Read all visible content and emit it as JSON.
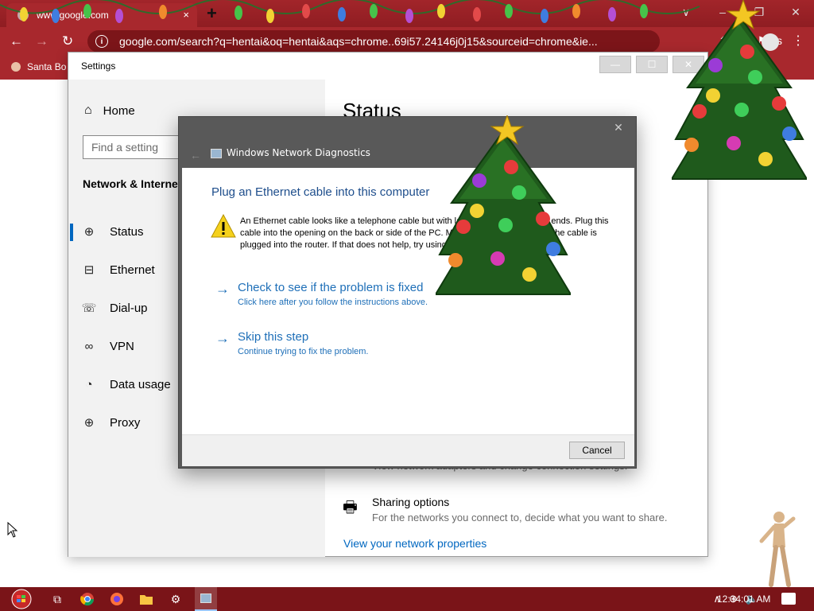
{
  "browser": {
    "tab_title": "www.google.com",
    "tab_close": "×",
    "new_tab": "+",
    "url": "google.com/search?q=hentai&oq=hentai&aqs=chrome..69i57.24146j0j15&sourceid=chrome&ie...",
    "info_glyph": "i",
    "bookmark_label": "Santa Bo",
    "ext_badge": "s",
    "win_ctrls": [
      "∨",
      "–",
      "❐",
      "✕"
    ]
  },
  "settings": {
    "title": "Settings",
    "home_label": "Home",
    "search_placeholder": "Find a setting",
    "section": "Network & Internet",
    "nav": [
      {
        "label": "Status",
        "icon": "status-icon"
      },
      {
        "label": "Ethernet",
        "icon": "ethernet-icon"
      },
      {
        "label": "Dial-up",
        "icon": "dialup-icon"
      },
      {
        "label": "VPN",
        "icon": "vpn-icon"
      },
      {
        "label": "Data usage",
        "icon": "data-usage-icon"
      },
      {
        "label": "Proxy",
        "icon": "proxy-icon"
      }
    ],
    "main_title": "Status",
    "adapter_text": "View network adapters and change connection settings.",
    "sharing_title": "Sharing options",
    "sharing_desc": "For the networks you connect to, decide what you want to share.",
    "view_props": "View your network properties"
  },
  "dialog": {
    "title": "Windows Network Diagnostics",
    "heading": "Plug an Ethernet cable into this computer",
    "message": "An Ethernet cable looks like a telephone cable but with larger connectors on the ends. Plug this cable into the opening on the back or side of the PC. Make sure the other end of the cable is plugged into the router. If that does not help, try using a different cable.",
    "options": [
      {
        "title": "Check to see if the problem is fixed",
        "desc": "Click here after you follow the instructions above."
      },
      {
        "title": "Skip this step",
        "desc": "Continue trying to fix the problem."
      }
    ],
    "cancel": "Cancel"
  },
  "taskbar": {
    "clock": "12:34:01 AM"
  }
}
